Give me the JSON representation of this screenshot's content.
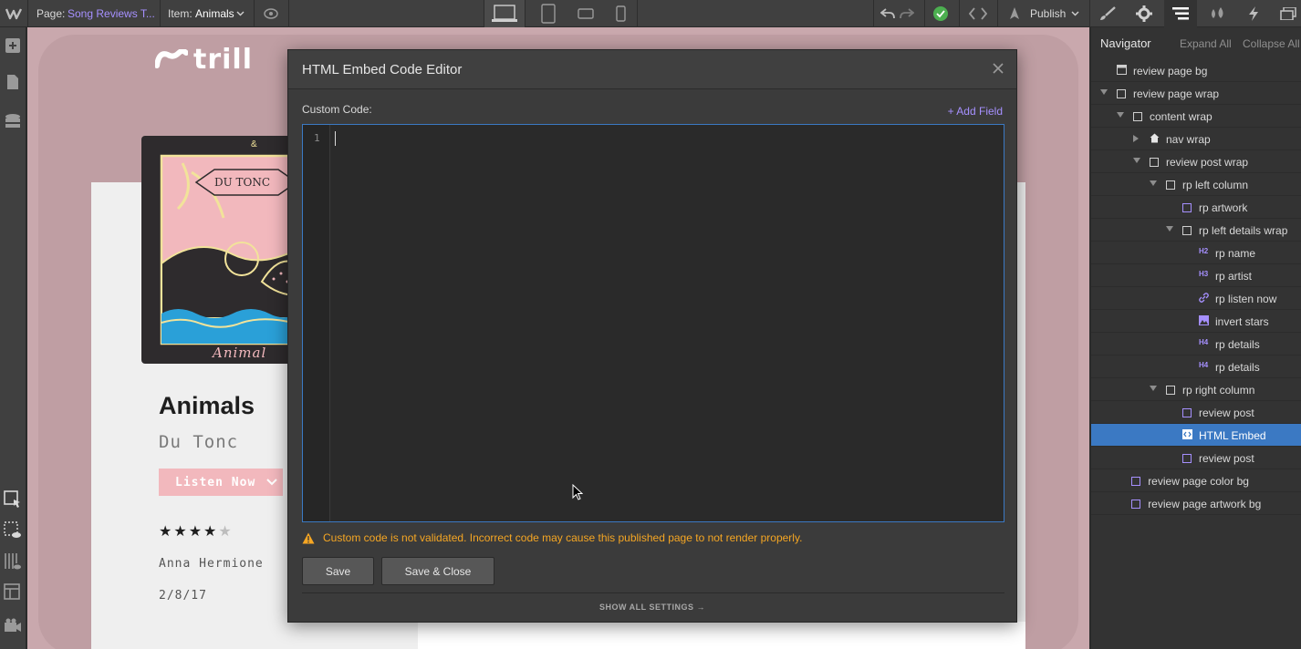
{
  "topbar": {
    "page_label": "Page:",
    "page_value": "Song Reviews T...",
    "item_label": "Item:",
    "item_value": "Animals",
    "publish_label": "Publish",
    "devices": [
      "desktop-icon",
      "tablet-icon",
      "landscape-phone-icon",
      "phone-icon"
    ],
    "right_tabs": [
      "brush-icon",
      "gear-icon",
      "navigator-icon",
      "drops-icon",
      "lightning-icon",
      "assets-icon"
    ]
  },
  "leftbar": {
    "icons": [
      "add-icon",
      "pages-icon",
      "cms-icon",
      "select-element-icon",
      "preview-hidden-icon",
      "guides-icon",
      "layout-icon",
      "video-icon"
    ]
  },
  "canvas": {
    "logo_text": "trill",
    "album_text": "DU TONC",
    "album_script": "Animal",
    "song_title": "Animals",
    "artist": "Du Tonc",
    "listen_label": "Listen Now",
    "rating": 4,
    "rating_max": 5,
    "reviewer": "Anna Hermione",
    "date": "2/8/17"
  },
  "modal": {
    "title": "HTML Embed Code Editor",
    "custom_code_label": "Custom Code:",
    "add_field_label": "+ Add Field",
    "line_number": "1",
    "warning": "Custom code is not validated. Incorrect code may cause this published page to not render properly.",
    "save_label": "Save",
    "save_close_label": "Save & Close",
    "show_all_settings": "SHOW ALL SETTINGS →"
  },
  "navigator": {
    "title": "Navigator",
    "expand_all": "Expand All",
    "collapse_all": "Collapse All",
    "items": [
      {
        "label": "review page bg",
        "icon": "page-icon"
      },
      {
        "label": "review page wrap",
        "icon": "box-icon"
      },
      {
        "label": "content wrap",
        "icon": "box-icon"
      },
      {
        "label": "nav wrap",
        "icon": "home-icon"
      },
      {
        "label": "review post wrap",
        "icon": "box-icon"
      },
      {
        "label": "rp left column",
        "icon": "box-icon"
      },
      {
        "label": "rp artwork",
        "icon": "box-purple-icon"
      },
      {
        "label": "rp left details wrap",
        "icon": "box-icon"
      },
      {
        "label": "rp name",
        "icon": "h2-icon",
        "tag": "H2"
      },
      {
        "label": "rp artist",
        "icon": "h3-icon",
        "tag": "H3"
      },
      {
        "label": "rp listen now",
        "icon": "link-icon"
      },
      {
        "label": "invert stars",
        "icon": "image-icon"
      },
      {
        "label": "rp details",
        "icon": "h4-icon",
        "tag": "H4"
      },
      {
        "label": "rp details",
        "icon": "h4-icon",
        "tag": "H4"
      },
      {
        "label": "rp right column",
        "icon": "box-icon"
      },
      {
        "label": "review post",
        "icon": "box-purple-icon"
      },
      {
        "label": "HTML Embed",
        "icon": "embed-icon",
        "selected": true
      },
      {
        "label": "review post",
        "icon": "box-purple-icon"
      },
      {
        "label": "review page color bg",
        "icon": "box-purple-icon"
      },
      {
        "label": "review page artwork bg",
        "icon": "box-purple-icon"
      }
    ]
  },
  "colors": {
    "accent_blue": "#3b79c3",
    "link_purple": "#a690ff",
    "warning_orange": "#f5a623",
    "success_green": "#4caf50"
  }
}
